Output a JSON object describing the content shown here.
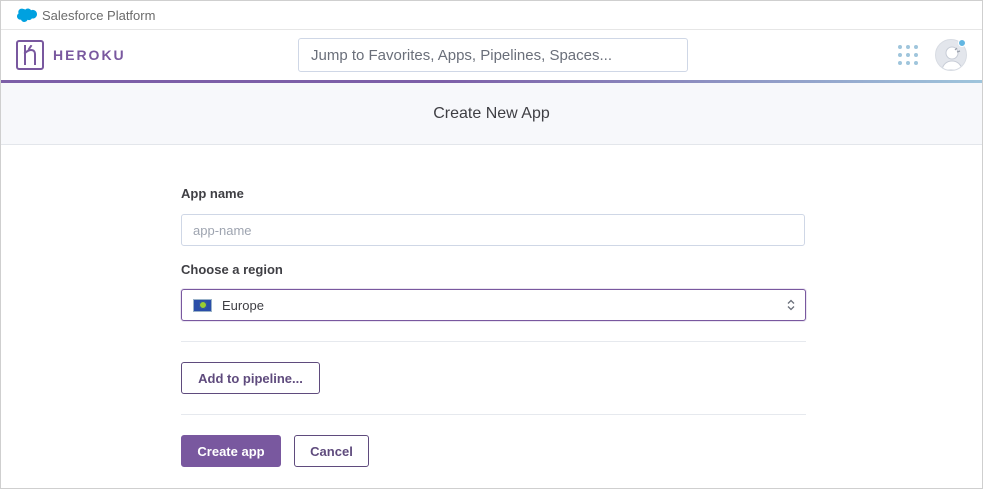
{
  "salesforce_bar": {
    "text": "Salesforce Platform"
  },
  "header": {
    "wordmark": "HEROKU",
    "search_placeholder": "Jump to Favorites, Apps, Pipelines, Spaces..."
  },
  "page": {
    "title": "Create New App"
  },
  "form": {
    "app_name_label": "App name",
    "app_name_placeholder": "app-name",
    "app_name_value": "",
    "region_label": "Choose a region",
    "region_value": "Europe",
    "add_pipeline_label": "Add to pipeline...",
    "create_label": "Create app",
    "cancel_label": "Cancel"
  },
  "colors": {
    "brand_purple": "#79589f",
    "accent_blue": "#9fc5dc",
    "salesforce_blue": "#00a1e0"
  },
  "icons": [
    "salesforce-cloud-icon",
    "heroku-logo-icon",
    "apps-grid-icon",
    "avatar-icon",
    "notification-dot-icon",
    "eu-flag-icon",
    "select-caret-icon"
  ]
}
